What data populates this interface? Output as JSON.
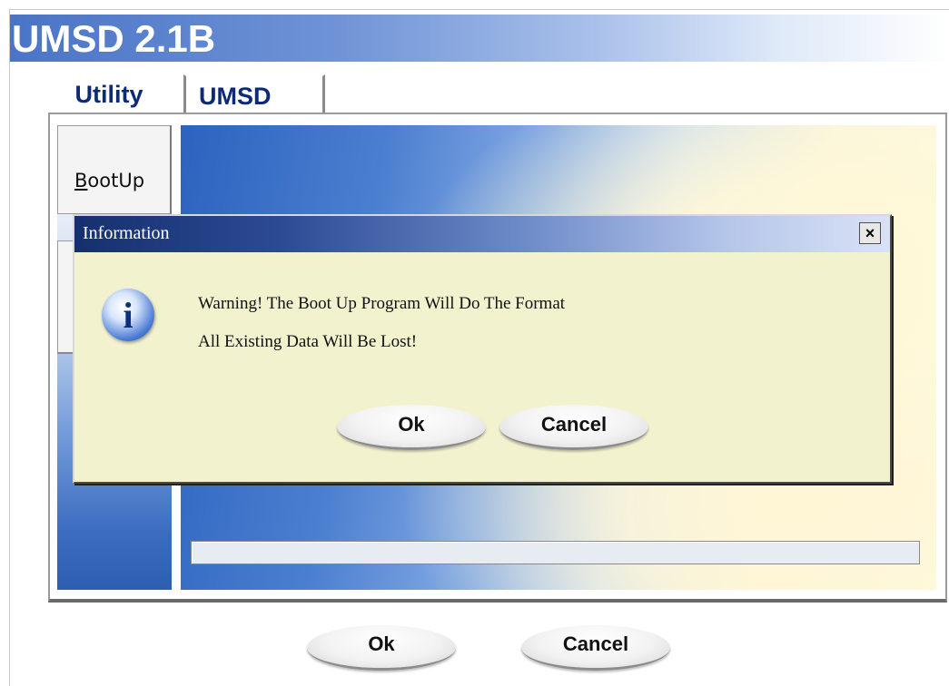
{
  "app": {
    "title": "UMSD 2.1B"
  },
  "tabs": [
    {
      "label": "Utility",
      "active": true
    },
    {
      "label": "UMSD",
      "active": false
    }
  ],
  "sidebar": {
    "bootup_label": "BootUp"
  },
  "main": {
    "progress": 0,
    "ok_label": "Ok",
    "cancel_label": "Cancel"
  },
  "dialog": {
    "title": "Information",
    "close_label": "×",
    "icon": "info-icon",
    "message_line1": "Warning! The Boot Up Program Will Do The Format",
    "message_line2": "All Existing Data Will Be Lost!",
    "ok_label": "Ok",
    "cancel_label": "Cancel"
  }
}
